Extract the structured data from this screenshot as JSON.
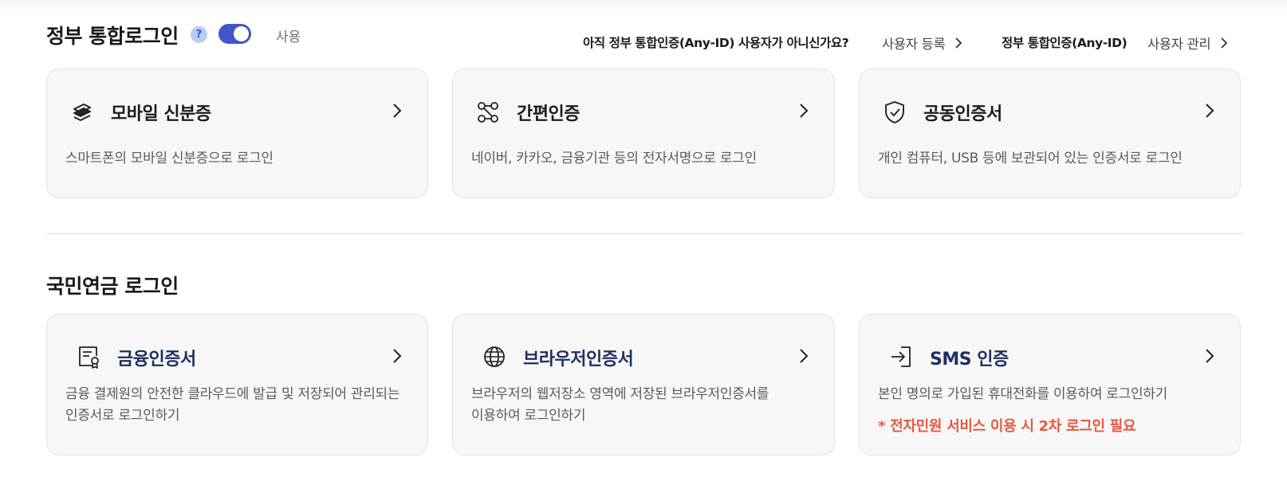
{
  "gov_login": {
    "title": "정부 통합로그인",
    "help_symbol": "?",
    "toggle_label": "사용",
    "no_account_question": "아직 정부 통합인증(Any-ID) 사용자가 아니신가요?",
    "register_link": "사용자 등록",
    "anyid_label": "정부 통합인증(Any-ID)",
    "manage_link": "사용자 관리",
    "cards": [
      {
        "title": "모바일 신분증",
        "desc": "스마트폰의 모바일 신분증으로 로그인",
        "icon": "mobile-id-icon"
      },
      {
        "title": "간편인증",
        "desc": "네이버, 카카오, 금융기관 등의 전자서명으로 로그인",
        "icon": "simple-auth-icon"
      },
      {
        "title": "공동인증서",
        "desc": "개인 컴퓨터, USB 등에 보관되어 있는 인증서로 로그인",
        "icon": "shield-check-icon"
      }
    ]
  },
  "nps_login": {
    "title": "국민연금 로그인",
    "cards": [
      {
        "title": "금융인증서",
        "desc_line1": "금융 결제원의 안전한 클라우드에 발급 및 저장되어 관리되는",
        "desc_line2": "인증서로 로그인하기",
        "icon": "certificate-icon"
      },
      {
        "title": "브라우저인증서",
        "desc_line1": "브라우저의 웹저장소 영역에 저장된 브라우저인증서를",
        "desc_line2": "이용하여 로그인하기",
        "icon": "globe-icon"
      },
      {
        "title": "SMS 인증",
        "desc_line1": "본인 명의로 가입된 휴대전화를 이용하여 로그인하기",
        "warning": "* 전자민원 서비스 이용 시 2차 로그인 필요",
        "icon": "login-arrow-icon"
      }
    ]
  },
  "colors": {
    "accent": "#3f55c9",
    "card_bg": "#f7f7f7",
    "warning": "#e8573f",
    "title_blue": "#1f2f62"
  }
}
